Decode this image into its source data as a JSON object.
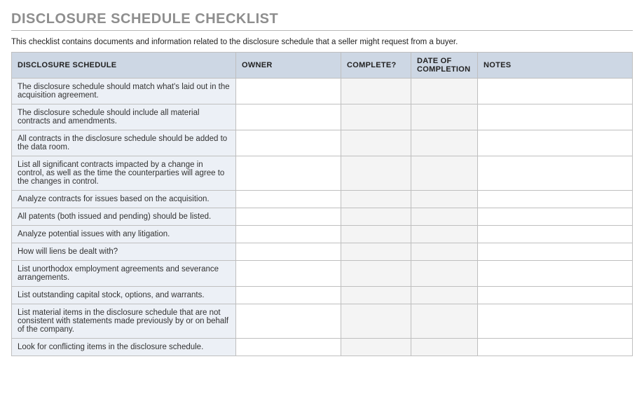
{
  "title": "DISCLOSURE SCHEDULE CHECKLIST",
  "intro": "This checklist contains documents and information related to the disclosure schedule that a seller might request from a buyer.",
  "headers": {
    "schedule": "DISCLOSURE SCHEDULE",
    "owner": "OWNER",
    "complete": "COMPLETE?",
    "date": "DATE OF COMPLETION",
    "notes": "NOTES"
  },
  "rows": [
    {
      "item": "The disclosure schedule should match what's laid out in the acquisition agreement.",
      "owner": "",
      "complete": "",
      "date": "",
      "notes": ""
    },
    {
      "item": "The disclosure schedule should include all material contracts and amendments.",
      "owner": "",
      "complete": "",
      "date": "",
      "notes": ""
    },
    {
      "item": "All contracts in the disclosure schedule should be added to the data room.",
      "owner": "",
      "complete": "",
      "date": "",
      "notes": ""
    },
    {
      "item": "List all significant contracts impacted by a change in control, as well as the time the counterparties will agree to the changes in control.",
      "owner": "",
      "complete": "",
      "date": "",
      "notes": ""
    },
    {
      "item": "Analyze contracts for issues based on the acquisition.",
      "owner": "",
      "complete": "",
      "date": "",
      "notes": ""
    },
    {
      "item": "All patents (both issued and pending) should be listed.",
      "owner": "",
      "complete": "",
      "date": "",
      "notes": ""
    },
    {
      "item": "Analyze potential issues with any litigation.",
      "owner": "",
      "complete": "",
      "date": "",
      "notes": ""
    },
    {
      "item": "How will liens be dealt with?",
      "owner": "",
      "complete": "",
      "date": "",
      "notes": ""
    },
    {
      "item": "List unorthodox employment agreements and severance arrangements.",
      "owner": "",
      "complete": "",
      "date": "",
      "notes": ""
    },
    {
      "item": "List outstanding capital stock, options, and warrants.",
      "owner": "",
      "complete": "",
      "date": "",
      "notes": ""
    },
    {
      "item": "List material items in the disclosure schedule that are not consistent with statements made previously by or on behalf of the company.",
      "owner": "",
      "complete": "",
      "date": "",
      "notes": ""
    },
    {
      "item": "Look for conflicting items in the disclosure schedule.",
      "owner": "",
      "complete": "",
      "date": "",
      "notes": ""
    }
  ]
}
